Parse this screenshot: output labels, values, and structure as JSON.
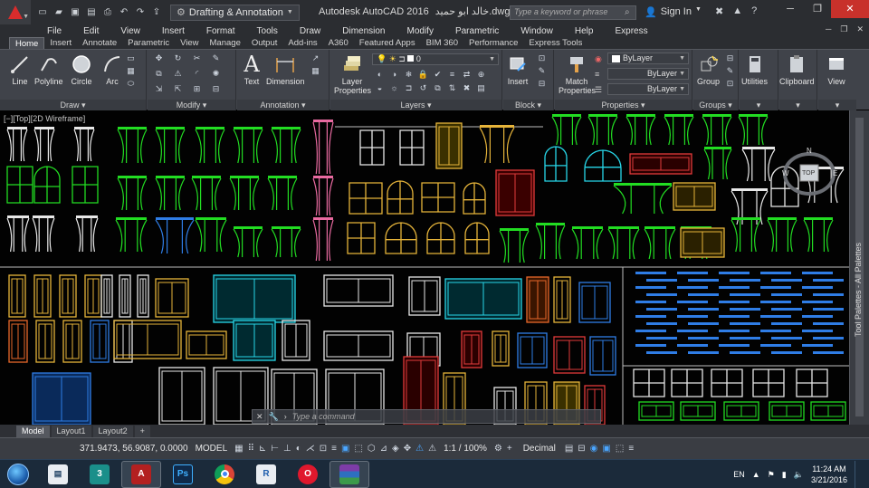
{
  "titlebar": {
    "workspace": "Drafting & Annotation",
    "title": "Autodesk AutoCAD 2016",
    "filename": "خالد ابو حميد.dwg",
    "search_placeholder": "Type a keyword or phrase",
    "signin": "Sign In"
  },
  "menu": [
    "File",
    "Edit",
    "View",
    "Insert",
    "Format",
    "Tools",
    "Draw",
    "Dimension",
    "Modify",
    "Parametric",
    "Window",
    "Help",
    "Express"
  ],
  "ribbon_tabs": [
    "Home",
    "Insert",
    "Annotate",
    "Parametric",
    "View",
    "Manage",
    "Output",
    "Add-ins",
    "A360",
    "Featured Apps",
    "BIM 360",
    "Performance",
    "Express Tools"
  ],
  "ribbon": {
    "draw": {
      "title": "Draw",
      "line": "Line",
      "polyline": "Polyline",
      "circle": "Circle",
      "arc": "Arc"
    },
    "modify": {
      "title": "Modify"
    },
    "annotation": {
      "title": "Annotation",
      "text": "Text",
      "dimension": "Dimension"
    },
    "layers": {
      "title": "Layers",
      "layer_properties": "Layer Properties",
      "current_layer": "0"
    },
    "block": {
      "title": "Block",
      "insert": "Insert"
    },
    "properties": {
      "title": "Properties",
      "match_properties": "Match Properties",
      "color": "ByLayer",
      "linetype": "ByLayer",
      "lineweight": "ByLayer"
    },
    "groups": {
      "title": "Groups",
      "group": "Group"
    },
    "utilities": "Utilities",
    "clipboard": "Clipboard",
    "view": "View"
  },
  "viewport_label": "[−][Top][2D Wireframe]",
  "viewcube": {
    "top": "TOP",
    "n": "N",
    "w": "W",
    "e": "E"
  },
  "tool_palettes": "Tool Palettes - All Palettes",
  "command_placeholder": "Type a command",
  "layout_tabs": [
    "Model",
    "Layout1",
    "Layout2"
  ],
  "status": {
    "coords": "371.9473, 56.9087, 0.0000",
    "model": "MODEL",
    "scale": "1:1 / 100%",
    "units": "Decimal"
  },
  "taskbar": {
    "apps": [
      "explorer",
      "3ds-max",
      "autocad",
      "photoshop",
      "chrome",
      "revit",
      "opera",
      "winrar"
    ],
    "lang": "EN",
    "time": "11:24 AM",
    "date": "3/21/2016"
  },
  "colors": {
    "bg": "#000000",
    "ribbon": "#40434a",
    "accent": "#4aa6ff",
    "autocad_red": "#d82c2c"
  }
}
